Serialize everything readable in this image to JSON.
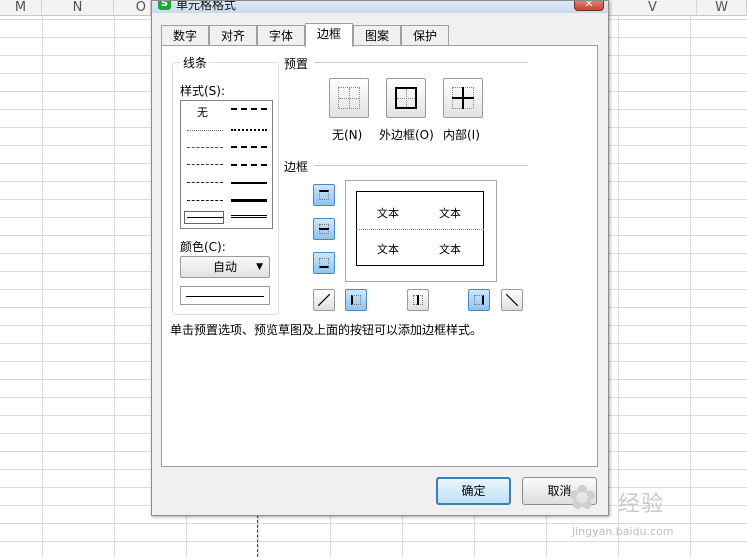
{
  "sheet": {
    "columns": [
      {
        "label": "M"
      },
      {
        "label": "N"
      },
      {
        "label": "O"
      },
      {
        "label": "V"
      },
      {
        "label": "W"
      }
    ]
  },
  "dialog": {
    "title": "单元格格式",
    "close_symbol": "✕",
    "tabs": [
      {
        "label": "数字"
      },
      {
        "label": "对齐"
      },
      {
        "label": "字体"
      },
      {
        "label": "边框"
      },
      {
        "label": "图案"
      },
      {
        "label": "保护"
      }
    ],
    "active_tab": "边框",
    "line": {
      "group_label": "线条",
      "style_label": "样式(S):",
      "style_none": "无",
      "color_label": "颜色(C):",
      "color_value": "自动"
    },
    "preset": {
      "title": "预置",
      "options": [
        {
          "label": "无(N)"
        },
        {
          "label": "外边框(O)"
        },
        {
          "label": "内部(I)"
        }
      ]
    },
    "border": {
      "title": "边框",
      "preview_cells": [
        "文本",
        "文本",
        "文本",
        "文本"
      ]
    },
    "hint": "单击预置选项、预览草图及上面的按钮可以添加边框样式。",
    "ok_label": "确定",
    "cancel_label": "取消"
  },
  "watermark": {
    "brand": "经验",
    "url": "jingyan.baidu.com"
  },
  "colors": {
    "accent": "#3c7fb1",
    "toggle_on": "#8fc4f0",
    "close": "#c9452e"
  }
}
